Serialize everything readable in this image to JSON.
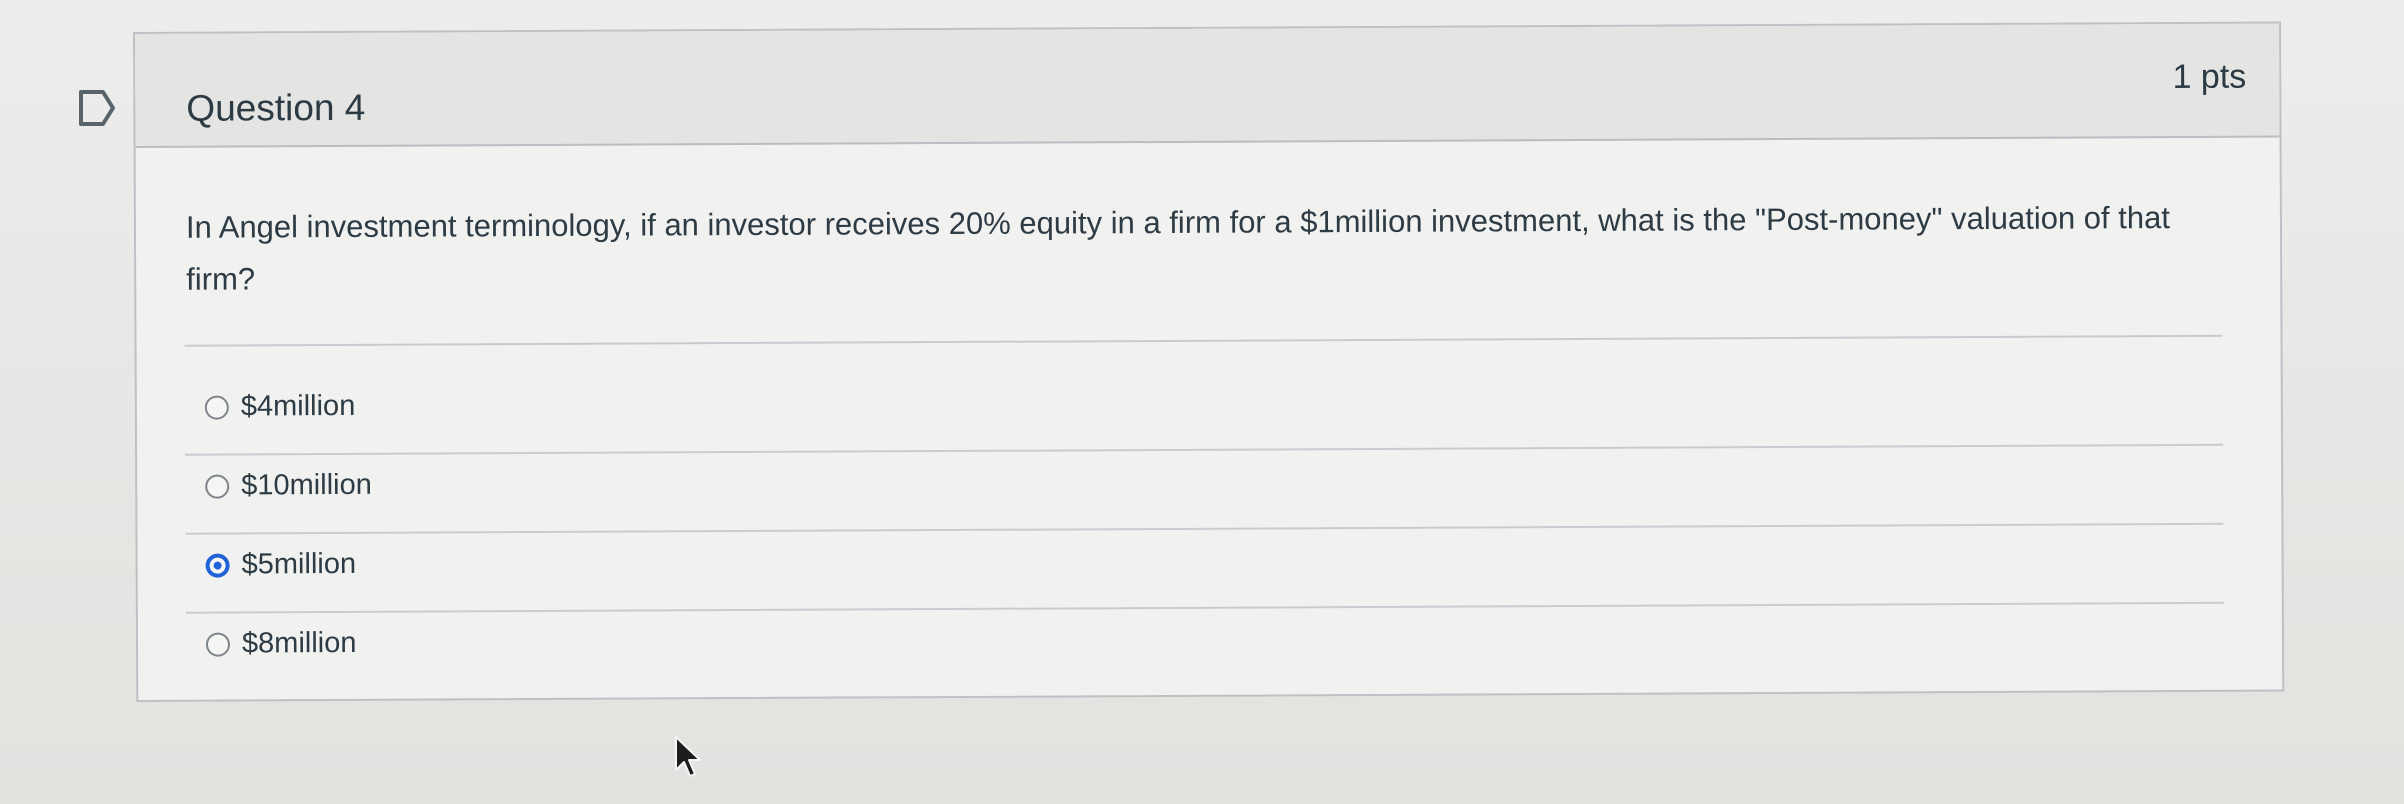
{
  "question": {
    "title": "Question 4",
    "points": "1 pts",
    "prompt": "In Angel investment terminology, if an investor receives 20% equity in a firm for a $1million investment, what is the \"Post-money\" valuation of that firm?",
    "selected_answer": "$5million",
    "answers": [
      {
        "label": "$4million",
        "selected": false
      },
      {
        "label": "$10million",
        "selected": false
      },
      {
        "label": "$5million",
        "selected": true
      },
      {
        "label": "$8million",
        "selected": false
      }
    ]
  },
  "icons": {
    "flag": "flag-icon",
    "radio": "radio-button",
    "cursor": "mouse-cursor-icon"
  },
  "colors": {
    "accent": "#1f63d7",
    "text": "#2d3b45",
    "border": "#bcc1c5"
  }
}
